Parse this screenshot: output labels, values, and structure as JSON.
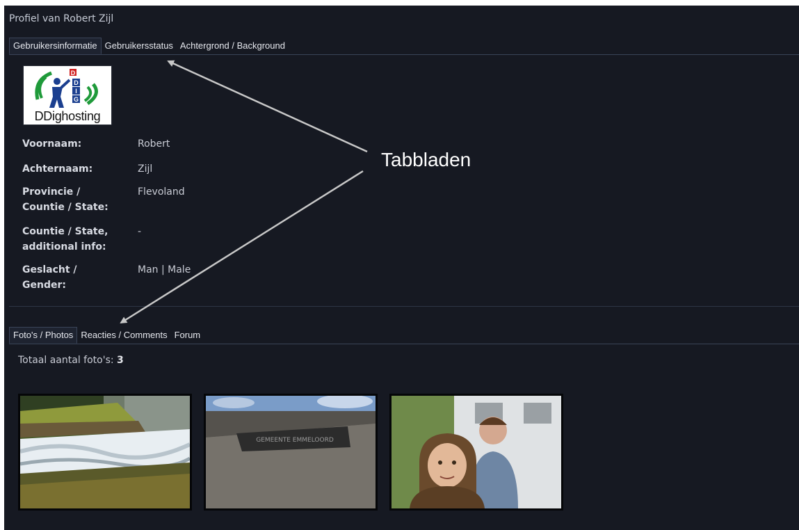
{
  "page_title": "Profiel van Robert Zijl",
  "profile_tabs": [
    "Gebruikersinformatie",
    "Gebruikersstatus",
    "Achtergrond / Background"
  ],
  "logo": {
    "text": "DDighosting",
    "badge": "D",
    "stack_letters": [
      "D",
      "I",
      "G"
    ]
  },
  "fields": [
    {
      "label_lines": [
        "Voornaam:"
      ],
      "value": "Robert"
    },
    {
      "label_lines": [
        "Achternaam:"
      ],
      "value": "Zijl"
    },
    {
      "label_lines": [
        "Provincie /",
        "Countie / State:"
      ],
      "value": "Flevoland"
    },
    {
      "label_lines": [
        "Countie / State,",
        "additional info:"
      ],
      "value": "-"
    },
    {
      "label_lines": [
        "Geslacht /",
        "Gender:"
      ],
      "value": "Man | Male"
    }
  ],
  "content_tabs": [
    "Foto's / Photos",
    "Reacties / Comments",
    "Forum"
  ],
  "photos": {
    "total_label": "Totaal aantal foto's:",
    "total_count": "3",
    "sign_text": "GEMEENTE EMMELOORD"
  },
  "annotation": {
    "label": "Tabbladen"
  },
  "colors": {
    "background": "#161922",
    "text": "#c9ccd5",
    "tab_border": "#3a4458",
    "annotation_arrow": "#c8c8c8"
  }
}
